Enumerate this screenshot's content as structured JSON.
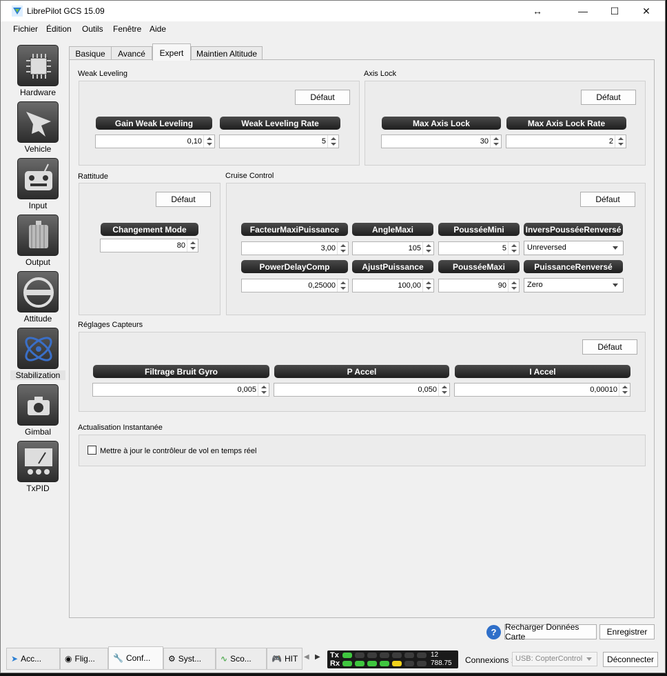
{
  "window": {
    "title": "LibrePilot GCS 15.09",
    "controls": [
      "↔",
      "—",
      "☐",
      "✕"
    ]
  },
  "menu": [
    "Fichier",
    "Édition",
    "Outils",
    "Fenêtre",
    "Aide"
  ],
  "sidebar": [
    {
      "label": "Hardware",
      "icon": "chip-icon"
    },
    {
      "label": "Vehicle",
      "icon": "plane-icon"
    },
    {
      "label": "Input",
      "icon": "transmitter-icon"
    },
    {
      "label": "Output",
      "icon": "motor-icon"
    },
    {
      "label": "Attitude",
      "icon": "level-icon"
    },
    {
      "label": "Stabilization",
      "icon": "gyro-icon",
      "selected": true
    },
    {
      "label": "Gimbal",
      "icon": "camera-icon"
    },
    {
      "label": "TxPID",
      "icon": "meter-icon"
    }
  ],
  "tabs": [
    "Basique",
    "Avancé",
    "Expert",
    "Maintien Altitude"
  ],
  "default_label": "Défaut",
  "weak": {
    "title": "Weak Leveling",
    "labels": [
      "Gain Weak Leveling",
      "Weak Leveling Rate"
    ],
    "values": [
      "0,10",
      "5"
    ]
  },
  "axis": {
    "title": "Axis Lock",
    "labels": [
      "Max Axis Lock",
      "Max Axis Lock Rate"
    ],
    "values": [
      "30",
      "2"
    ]
  },
  "ratt": {
    "title": "Rattitude",
    "label": "Changement Mode",
    "value": "80"
  },
  "cruise": {
    "title": "Cruise Control",
    "row1": {
      "labels": [
        "FacteurMaxiPuissance",
        "AngleMaxi",
        "PousséeMini",
        "InversPousséeRenversé"
      ],
      "values": [
        "3,00",
        "105",
        "5"
      ],
      "combo": "Unreversed"
    },
    "row2": {
      "labels": [
        "PowerDelayComp",
        "AjustPuissance",
        "PousséeMaxi",
        "PuissanceRenversé"
      ],
      "values": [
        "0,25000",
        "100,00",
        "90"
      ],
      "combo": "Zero"
    }
  },
  "sensors": {
    "title": "Réglages Capteurs",
    "labels": [
      "Filtrage Bruit Gyro",
      "P Accel",
      "I Accel"
    ],
    "values": [
      "0,005",
      "0,050",
      "0,00010"
    ]
  },
  "instant": {
    "title": "Actualisation Instantanée",
    "checkbox": "Mettre à jour le contrôleur de vol en temps réel"
  },
  "footer": {
    "help": "?",
    "reload": "Recharger Données Carte",
    "save": "Enregistrer"
  },
  "bottom_tabs": [
    {
      "label": "Acc...",
      "icon": "plane-small-icon"
    },
    {
      "label": "Flig...",
      "icon": "flight-icon"
    },
    {
      "label": "Conf...",
      "icon": "wrench-icon"
    },
    {
      "label": "Syst...",
      "icon": "gear-icon"
    },
    {
      "label": "Sco...",
      "icon": "scope-icon"
    },
    {
      "label": "HIT",
      "icon": "gamepad-icon"
    }
  ],
  "telemetry": {
    "tx_label": "Tx",
    "rx_label": "Rx",
    "tx_value": "12",
    "rx_value": "788.75"
  },
  "connections": {
    "label": "Connexions :",
    "device": "USB: CopterControl",
    "disconnect": "Déconnecter"
  }
}
